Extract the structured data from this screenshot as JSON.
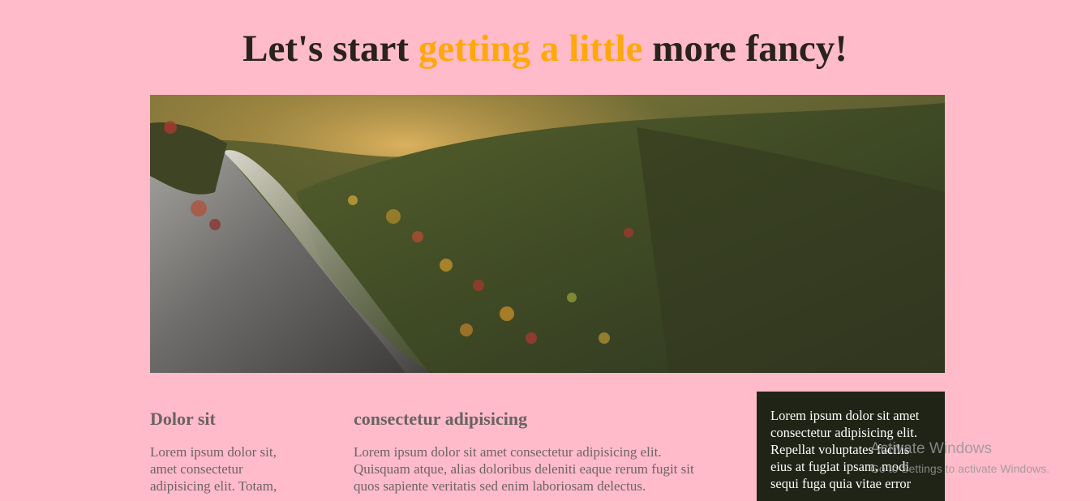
{
  "header": {
    "title_before": "Let's start ",
    "title_accent": "getting a little",
    "title_after": " more fancy!",
    "accent_color": "#ffa80a",
    "text_color": "#2a221c"
  },
  "hero": {
    "subject": "autumn-forest-mountain-photo"
  },
  "columns": [
    {
      "heading": "Dolor sit",
      "body": "Lorem ipsum dolor sit, amet consectetur adipisicing elit. Totam,"
    },
    {
      "heading": "consectetur adipisicing",
      "body": "Lorem ipsum dolor sit amet consectetur adipisicing elit. Quisquam atque, alias doloribus deleniti eaque rerum fugit sit quos sapiente veritatis sed enim laboriosam delectus."
    }
  ],
  "aside": {
    "body": "Lorem ipsum dolor sit amet consectetur adipisicing elit. Repellat voluptates facilis eius at fugiat ipsam, modi sequi fuga quia vitae error",
    "background": "#1f2416"
  },
  "os_overlay": {
    "title": "Activate Windows",
    "subtitle": "Go to Settings to activate Windows."
  },
  "colors": {
    "page_background": "#ffbbc9",
    "muted_text": "#6d6464"
  }
}
